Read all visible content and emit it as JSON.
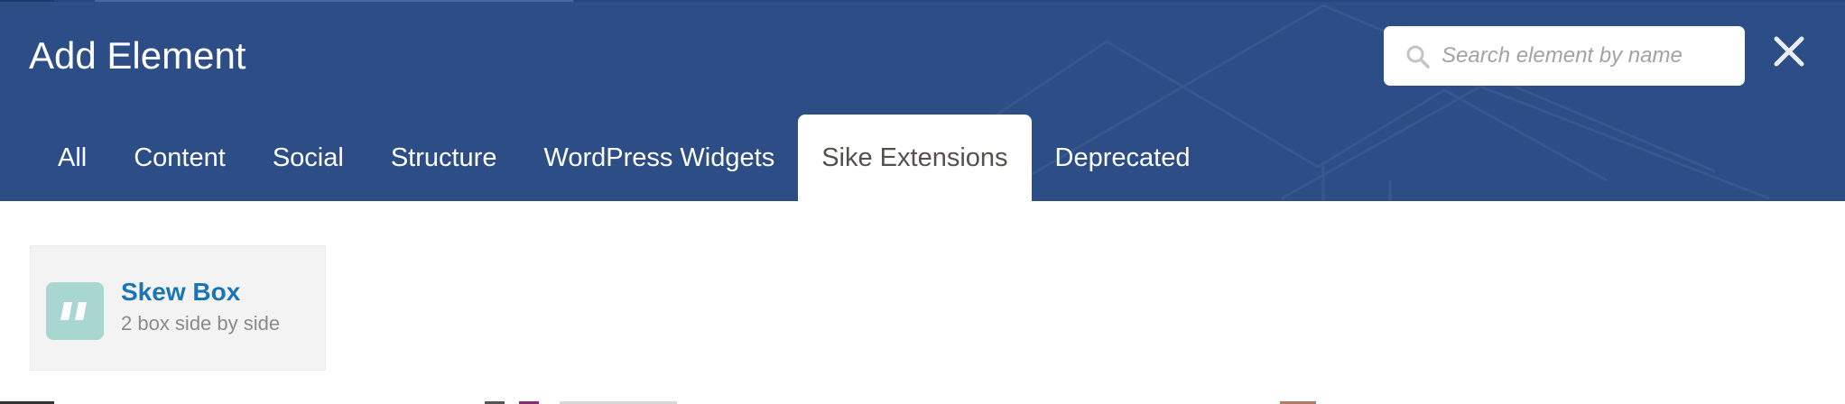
{
  "header": {
    "title": "Add Element",
    "search": {
      "placeholder": "Search element by name",
      "value": ""
    },
    "close_icon": "close-icon"
  },
  "tabs": [
    {
      "label": "All",
      "active": false
    },
    {
      "label": "Content",
      "active": false
    },
    {
      "label": "Social",
      "active": false
    },
    {
      "label": "Structure",
      "active": false
    },
    {
      "label": "WordPress Widgets",
      "active": false
    },
    {
      "label": "Sike Extensions",
      "active": true
    },
    {
      "label": "Deprecated",
      "active": false
    }
  ],
  "elements": [
    {
      "name": "Skew Box",
      "description": "2 box side by side",
      "icon": "skew-box-icon",
      "icon_color": "#a8d6d1"
    }
  ],
  "colors": {
    "header_bg": "#2c4d85",
    "active_tab_bg": "#ffffff",
    "active_tab_text": "#55504b",
    "element_name": "#1b75b5",
    "element_desc": "#8a8a8a",
    "card_bg": "#f3f3f3"
  }
}
